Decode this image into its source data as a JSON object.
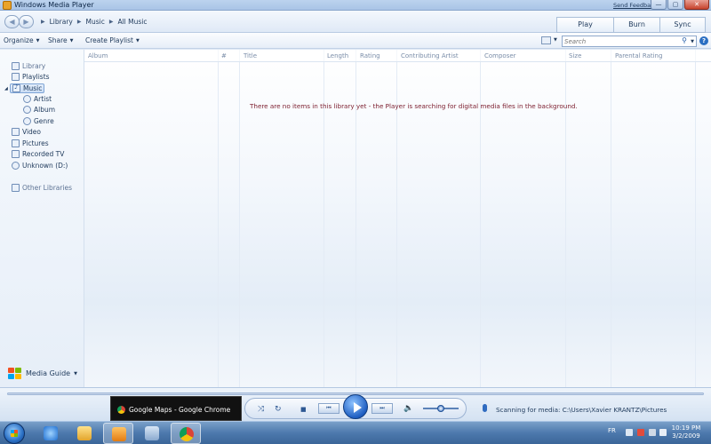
{
  "window": {
    "title": "Windows Media Player",
    "send_feedback": "Send Feedback",
    "minimize_glyph": "—",
    "maximize_glyph": "▢",
    "close_glyph": "✕"
  },
  "address": {
    "back_glyph": "◀",
    "forward_glyph": "▶",
    "breadcrumb": [
      "Library",
      "Music",
      "All Music"
    ],
    "separator": "▶",
    "tabs": [
      "Play",
      "Burn",
      "Sync"
    ]
  },
  "toolbar": {
    "organize": "Organize",
    "share": "Share",
    "create_playlist": "Create Playlist",
    "caret": "▼",
    "search_placeholder": "Search",
    "search_icon": "⚲",
    "help": "?"
  },
  "nav": {
    "library": "Library",
    "playlists": "Playlists",
    "music": "Music",
    "artist": "Artist",
    "album": "Album",
    "genre": "Genre",
    "video": "Video",
    "pictures": "Pictures",
    "recorded_tv": "Recorded TV",
    "unknown": "Unknown (D:)",
    "other_libraries": "Other Libraries",
    "media_guide": "Media Guide",
    "expand_glyph": "◢"
  },
  "main": {
    "columns": [
      "Album",
      "#",
      "Title",
      "Length",
      "Rating",
      "Contributing Artist",
      "Composer",
      "Size",
      "Parental Rating"
    ],
    "empty_message": "There are no items in this library yet - the Player is searching for digital media files in the background."
  },
  "player": {
    "thumbnail_title": "Google Maps - Google Chrome",
    "shuffle_glyph": "⤨",
    "repeat_glyph": "↻",
    "stop_glyph": "■",
    "prev_glyph": "⏮",
    "next_glyph": "⏭",
    "mute_glyph": "🔈",
    "volume": 0.5,
    "status": "Scanning for media: C:\\Users\\Xavier KRANTZ\\Pictures"
  },
  "taskbar": {
    "language": "FR",
    "time": "10:19 PM",
    "date": "3/2/2009"
  },
  "colors": {
    "accent": "#2b6fc2",
    "empty_message": "#7b1d2d",
    "taskbar": "#4d79ad"
  }
}
